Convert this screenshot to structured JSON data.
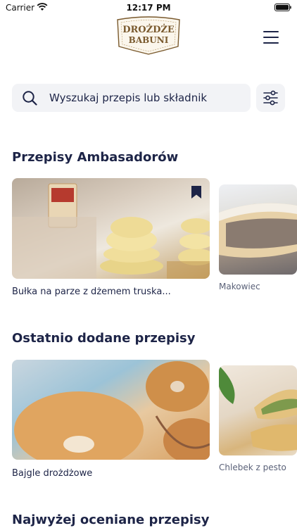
{
  "status_bar": {
    "carrier": "Carrier",
    "time": "12:17 PM"
  },
  "header": {
    "logo_line1": "DROŻDŻE",
    "logo_line2": "BABUNI"
  },
  "search": {
    "placeholder": "Wyszukaj przepis lub składnik",
    "value": ""
  },
  "sections": {
    "ambassadors": {
      "title": "Przepisy Ambasadorów",
      "cards": [
        {
          "label": "Bułka na parze z dżemem truska...",
          "bookmarked": true
        },
        {
          "label": "Makowiec"
        }
      ]
    },
    "recent": {
      "title": "Ostatnio dodane przepisy",
      "cards": [
        {
          "label": "Bajgle drożdżowe"
        },
        {
          "label": "Chlebek z pesto"
        }
      ]
    },
    "top_rated": {
      "title": "Najwyżej oceniane przepisy"
    }
  },
  "colors": {
    "text_dark": "#1d2447",
    "search_bg": "#f2f3f6",
    "logo_brown": "#7a5a2e"
  }
}
